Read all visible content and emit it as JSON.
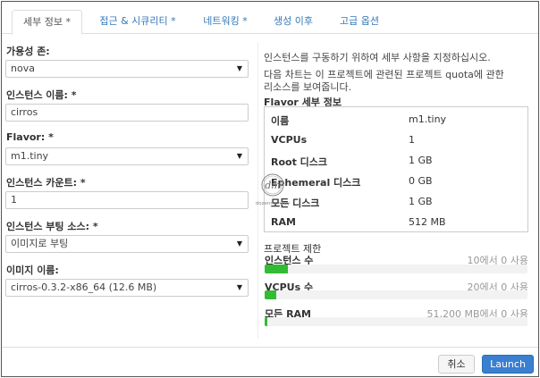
{
  "tabs": [
    "세부 정보 *",
    "접근 & 시큐리티 *",
    "네트워킹 *",
    "생성 이후",
    "고급 옵션"
  ],
  "form": {
    "availability_zone": {
      "label": "가용성 존:",
      "value": "nova"
    },
    "instance_name": {
      "label": "인스턴스 이름: *",
      "value": "cirros"
    },
    "flavor": {
      "label": "Flavor: *",
      "value": "m1.tiny"
    },
    "instance_count": {
      "label": "인스턴스 카운트: *",
      "value": "1"
    },
    "boot_source": {
      "label": "인스턴스 부팅 소스: *",
      "value": "이미지로 부팅"
    },
    "image_name": {
      "label": "이미지 이름:",
      "value": "cirros-0.3.2-x86_64 (12.6 MB)"
    }
  },
  "info": {
    "line1": "인스턴스를 구동하기 위하여 세부 사항을 지정하십시오.",
    "line2": "다음 차트는 이 프로젝트에 관련된 프로젝트 quota에 관한",
    "line3": "리소스를 보여줍니다."
  },
  "flavor_details": {
    "title": "Flavor 세부 정보",
    "rows": [
      {
        "key": "이름",
        "value": "m1.tiny"
      },
      {
        "key": "VCPUs",
        "value": "1"
      },
      {
        "key": "Root 디스크",
        "value": "1 GB"
      },
      {
        "key": "Ephemeral 디스크",
        "value": "0 GB"
      },
      {
        "key": "모든 디스크",
        "value": "1 GB"
      },
      {
        "key": "RAM",
        "value": "512 MB"
      }
    ]
  },
  "project_limits": {
    "title": "프로젝트 제한",
    "items": [
      {
        "label": "인스턴스 수",
        "text": "10에서 0 사용",
        "fraction": 0.09,
        "color": "#33bb33"
      },
      {
        "label": "VCPUs 수",
        "text": "20에서 0 사용",
        "fraction": 0.045,
        "color": "#33bb33"
      },
      {
        "label": "모든 RAM",
        "text": "51,200 MB에서 0 사용",
        "fraction": 0.01,
        "color": "#33bb33"
      }
    ]
  },
  "footer": {
    "cancel_label": "취소",
    "launch_label": "Launch"
  },
  "colors": {
    "accent": "#3a7fd0",
    "link": "#3479b7",
    "quota_fill": "#33bb33"
  },
  "watermark": {
    "text": "dozenmonkey"
  }
}
